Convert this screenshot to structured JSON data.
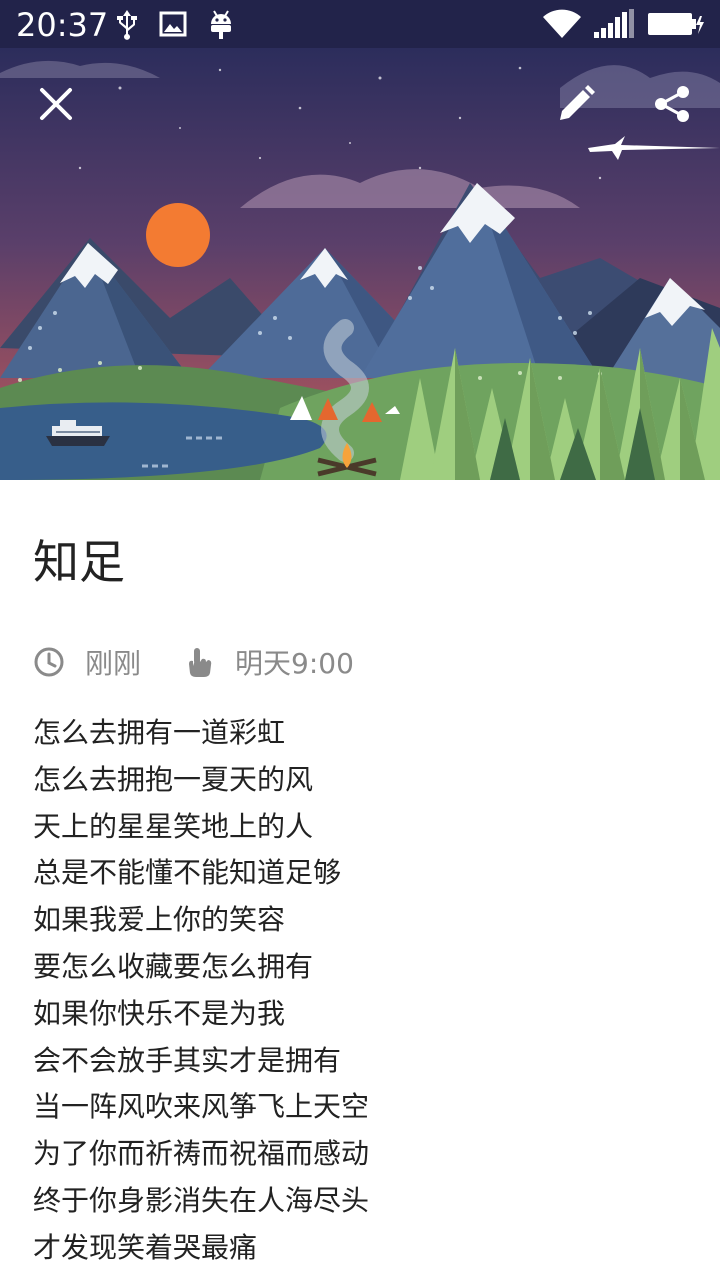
{
  "status_bar": {
    "time": "20:37"
  },
  "note": {
    "title": "知足",
    "created": "刚刚",
    "reminder": "明天9:00",
    "lines": [
      "怎么去拥有一道彩虹",
      "怎么去拥抱一夏天的风",
      "天上的星星笑地上的人",
      "总是不能懂不能知道足够",
      "如果我爱上你的笑容",
      "要怎么收藏要怎么拥有",
      "如果你快乐不是为我",
      "会不会放手其实才是拥有",
      "当一阵风吹来风筝飞上天空",
      "为了你而祈祷而祝福而感动",
      "终于你身影消失在人海尽头",
      "才发现笑着哭最痛"
    ]
  },
  "icons": {
    "close": "close-icon",
    "edit": "pencil-icon",
    "share": "share-icon",
    "created": "clock-icon",
    "reminder": "hand-pointer-icon"
  },
  "colors": {
    "status_bar": "#22234a",
    "sky_top": "#2c2d5c",
    "sky_bottom": "#c05a5a",
    "sun": "#f37b32",
    "text": "#222222",
    "meta_text": "#8a8a8a"
  }
}
